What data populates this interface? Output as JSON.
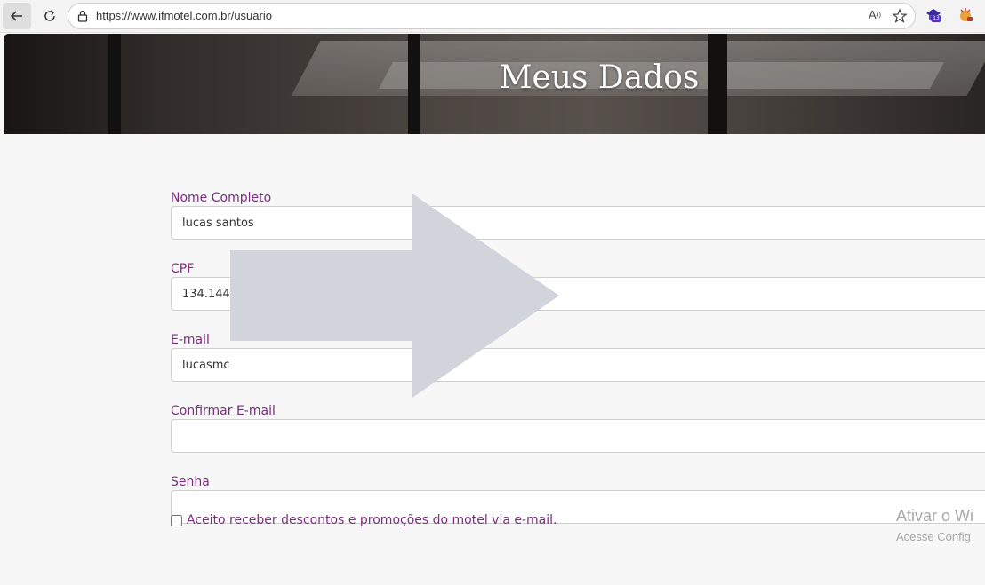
{
  "browser": {
    "url": "https://www.ifmotel.com.br/usuario",
    "read_aloud_label": "À»",
    "icons": [
      "back-arrow-icon",
      "reload-icon",
      "lock-icon",
      "read-aloud-icon",
      "favorite-star-icon",
      "extension-icon",
      "extension-icon-2"
    ],
    "extension_badge": "13"
  },
  "page": {
    "title": "Meus Dados"
  },
  "form": {
    "full_name": {
      "label": "Nome Completo",
      "value": "lucas santos"
    },
    "cpf": {
      "label": "CPF",
      "value": "134.144.0"
    },
    "email": {
      "label": "E-mail",
      "value": "lucasmc"
    },
    "confirm_email": {
      "label": "Confirmar E-mail",
      "value": ""
    },
    "password": {
      "label": "Senha",
      "value": ""
    },
    "newsletter": {
      "label": "Aceito receber descontos e promoções do motel via e-mail.",
      "checked": false
    }
  },
  "watermark": {
    "title": "Ativar o Wi",
    "subtitle": "Acesse Config"
  },
  "colors": {
    "label": "#7a2d7d",
    "arrow": "#d1d5db",
    "page_bg": "#f7f7f7"
  }
}
